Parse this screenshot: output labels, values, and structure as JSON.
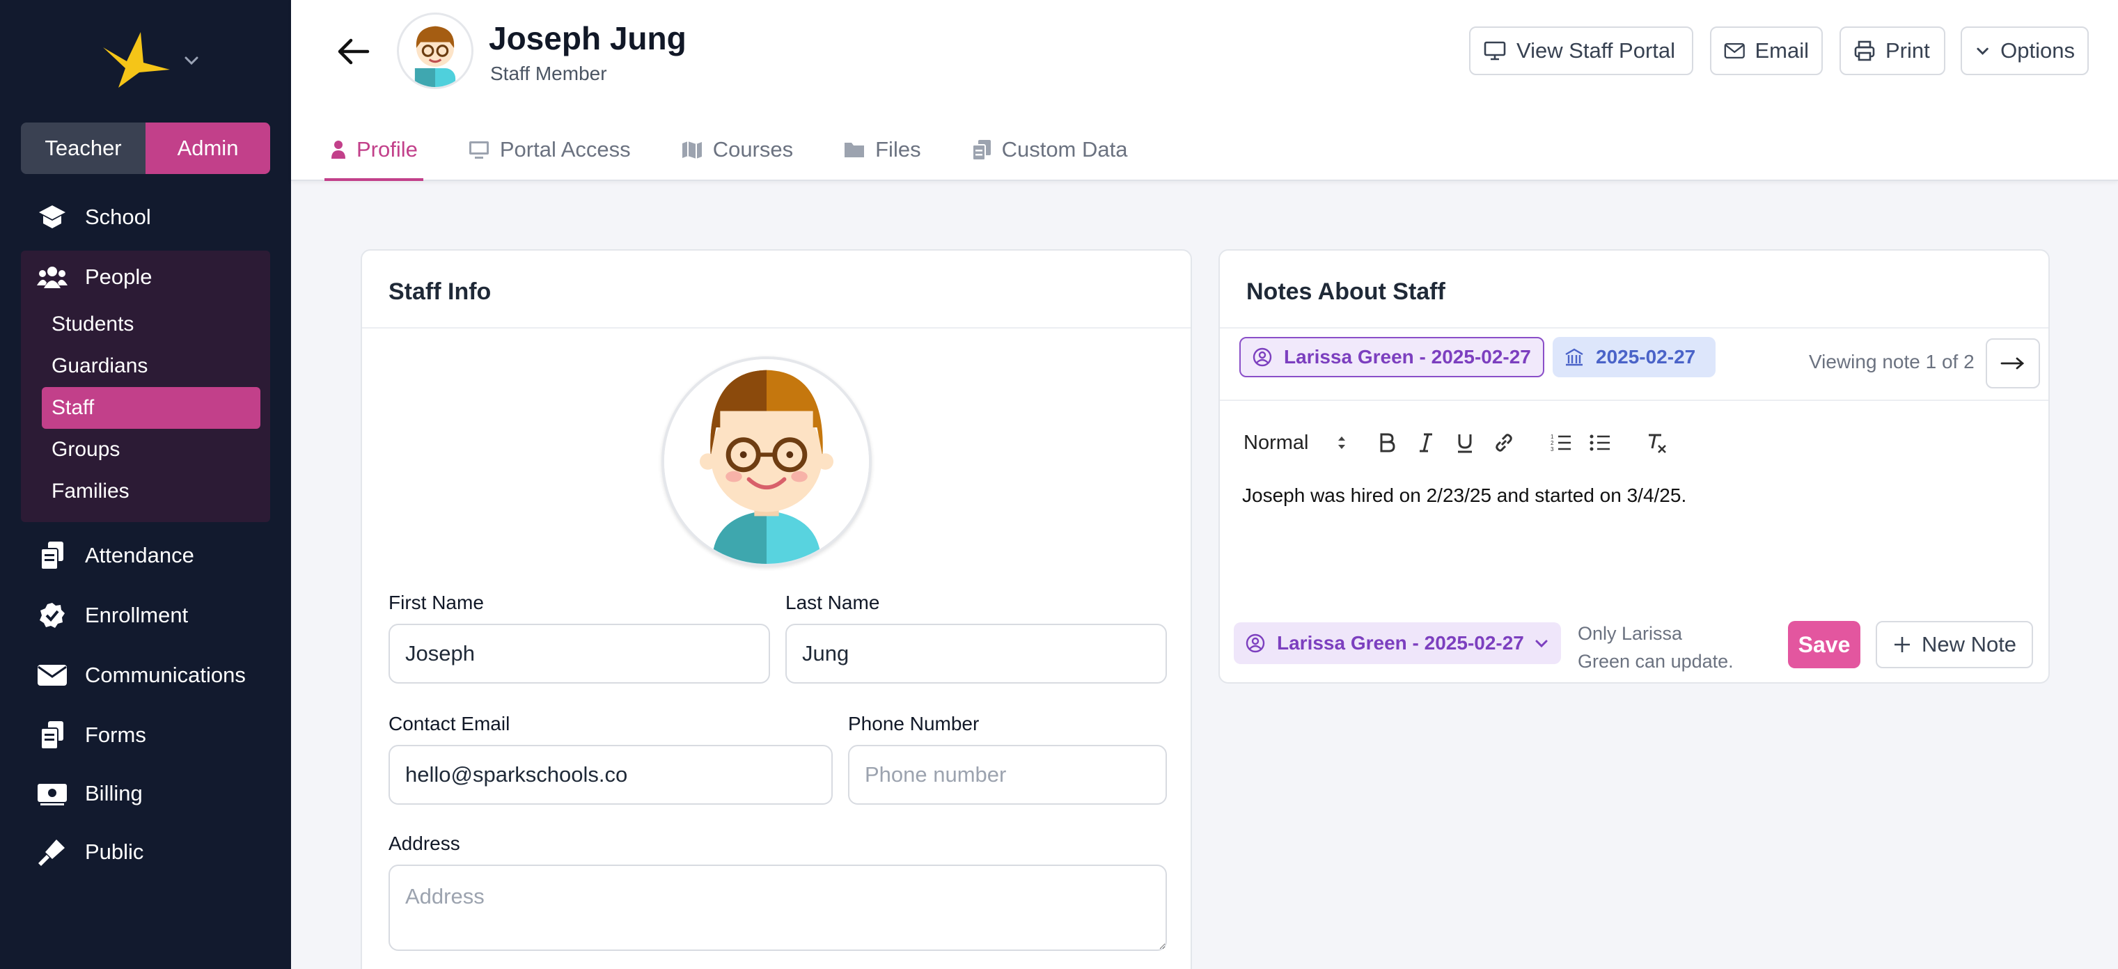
{
  "sidebar": {
    "role_toggle": {
      "teacher": "Teacher",
      "admin": "Admin",
      "active": "Admin"
    },
    "nav": [
      {
        "label": "School",
        "icon": "school-icon"
      },
      {
        "label": "People",
        "icon": "people-icon"
      },
      {
        "label": "Attendance",
        "icon": "attendance-icon"
      },
      {
        "label": "Enrollment",
        "icon": "enrollment-icon"
      },
      {
        "label": "Communications",
        "icon": "envelope-icon"
      },
      {
        "label": "Forms",
        "icon": "forms-icon"
      },
      {
        "label": "Billing",
        "icon": "billing-icon"
      },
      {
        "label": "Public",
        "icon": "public-icon"
      }
    ],
    "people_sub": [
      {
        "label": "Students"
      },
      {
        "label": "Guardians"
      },
      {
        "label": "Staff",
        "active": true
      },
      {
        "label": "Groups"
      },
      {
        "label": "Families"
      }
    ]
  },
  "header": {
    "name": "Joseph Jung",
    "subtitle": "Staff Member",
    "buttons": {
      "portal": "View Staff Portal",
      "email": "Email",
      "print": "Print",
      "options": "Options"
    },
    "tabs": [
      {
        "label": "Profile",
        "icon": "person-icon",
        "active": true
      },
      {
        "label": "Portal Access",
        "icon": "monitor-icon"
      },
      {
        "label": "Courses",
        "icon": "map-icon"
      },
      {
        "label": "Files",
        "icon": "folder-icon"
      },
      {
        "label": "Custom Data",
        "icon": "documents-icon"
      }
    ]
  },
  "staff_info": {
    "title": "Staff Info",
    "first_name_label": "First Name",
    "first_name": "Joseph",
    "last_name_label": "Last Name",
    "last_name": "Jung",
    "email_label": "Contact Email",
    "email": "hello@sparkschools.co",
    "phone_label": "Phone Number",
    "phone_placeholder": "Phone number",
    "address_label": "Address",
    "address_placeholder": "Address"
  },
  "notes": {
    "title": "Notes About Staff",
    "author_chip": "Larissa Green - 2025-02-27",
    "date_chip": "2025-02-27",
    "viewing": "Viewing note 1 of 2",
    "format_select": "Normal",
    "body": "Joseph was hired on 2/23/25 and started on 3/4/25.",
    "author_select": "Larissa Green - 2025-02-27",
    "only_update": "Only Larissa Green can update.",
    "save": "Save",
    "new_note": "New Note"
  },
  "colors": {
    "sidebar_bg": "#121a2e",
    "accent": "#c2408a",
    "save": "#e3569f",
    "chip_purple": "#7c3fbf",
    "chip_blue": "#4a63c8"
  }
}
